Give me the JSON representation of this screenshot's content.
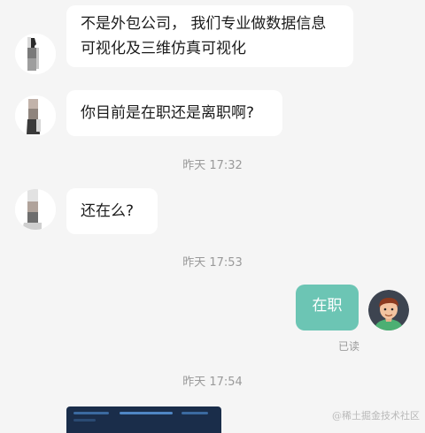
{
  "messages": [
    {
      "sender": "other",
      "text": "不是外包公司， 我们专业做数据信息可视化及三维仿真可视化"
    },
    {
      "sender": "other",
      "text": "你目前是在职还是离职啊?"
    },
    {
      "type": "time",
      "text": "昨天 17:32"
    },
    {
      "sender": "other",
      "text": "还在么?"
    },
    {
      "type": "time",
      "text": "昨天 17:53"
    },
    {
      "sender": "me",
      "text": "在职",
      "status": "已读"
    },
    {
      "type": "time",
      "text": "昨天 17:54"
    },
    {
      "sender": "other",
      "type": "image"
    }
  ],
  "watermark": "@稀土掘金技术社区",
  "colors": {
    "background": "#f5f5f5",
    "incoming_bubble": "#ffffff",
    "outgoing_bubble": "#6cc5b4",
    "timestamp_text": "#9a9a9a"
  },
  "icons": {
    "other_avatar": "person-silhouette-icon",
    "my_avatar": "cartoon-man-avatar-icon"
  }
}
